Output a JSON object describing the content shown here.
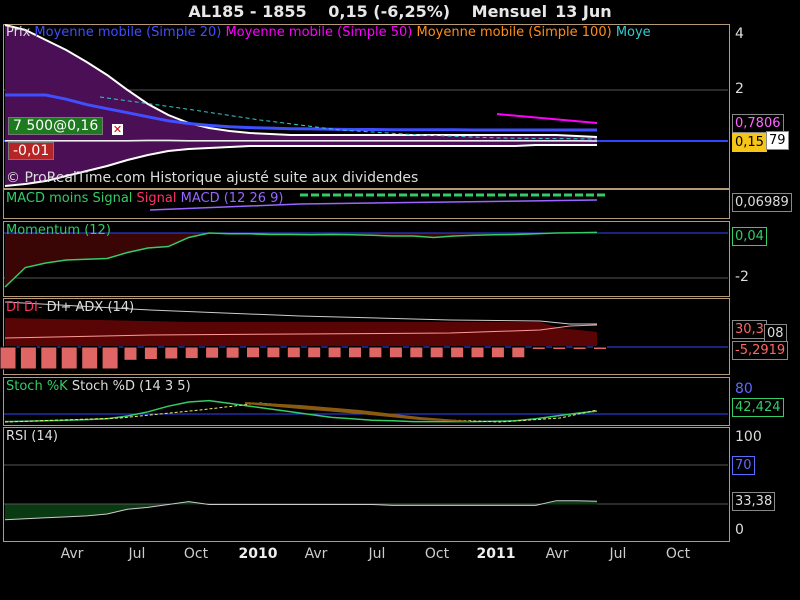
{
  "header": {
    "symbol": "AL185 - 1855",
    "price": "0,15 (-6,25%)",
    "period": "Mensuel",
    "date": "13 Jun"
  },
  "panels": {
    "price": {
      "legend": [
        {
          "text": "Prix",
          "color": "#dddddd"
        },
        {
          "text": "Moyenne mobile (Simple 20)",
          "color": "#3f4fff"
        },
        {
          "text": "Moyenne mobile (Simple 50)",
          "color": "#ff00ff"
        },
        {
          "text": "Moyenne mobile (Simple 100)",
          "color": "#ff8c1a"
        },
        {
          "text": "Moye",
          "color": "#33cccc"
        }
      ],
      "yticks": [
        "4",
        "2"
      ],
      "last_labels": [
        "0,7806",
        "0,15",
        "79"
      ],
      "order_tag": "7 500@0,16",
      "pl_tag": "-0,01",
      "source_note": "© ProRealTime.com Historique ajusté suite aux dividendes"
    },
    "macd": {
      "legend": [
        {
          "text": "MACD moins Signal",
          "color": "#33cc66"
        },
        {
          "text": "Signal",
          "color": "#ff3366"
        },
        {
          "text": "MACD (12 26 9)",
          "color": "#9966ff"
        }
      ],
      "last_label": "0,06989"
    },
    "momentum": {
      "legend": [
        {
          "text": "Momentum (12)",
          "color": "#33cc66"
        }
      ],
      "yticks": [
        "-2"
      ],
      "last_label": "0,04"
    },
    "dmi": {
      "legend": [
        {
          "text": "DI",
          "color": "#ff3366"
        },
        {
          "text": "DI-",
          "color": "#ff3366"
        },
        {
          "text": "DI+",
          "color": "#dddddd"
        },
        {
          "text": "ADX (14)",
          "color": "#dddddd"
        }
      ],
      "last_labels": [
        "30,3",
        "08",
        "-5,2919"
      ]
    },
    "stoch": {
      "legend": [
        {
          "text": "Stoch %K",
          "color": "#33cc66"
        },
        {
          "text": "Stoch %D (14 3 5)",
          "color": "#dddddd"
        }
      ],
      "yticks": [
        "80"
      ],
      "last_label": "42,424"
    },
    "rsi": {
      "legend": [
        {
          "text": "RSI (14)",
          "color": "#dddddd"
        }
      ],
      "yticks": [
        "100",
        "70",
        "0"
      ],
      "last_label": "33,38"
    }
  },
  "xaxis": [
    {
      "label": "Avr",
      "bold": false
    },
    {
      "label": "Jul",
      "bold": false
    },
    {
      "label": "Oct",
      "bold": false
    },
    {
      "label": "2010",
      "bold": true
    },
    {
      "label": "Avr",
      "bold": false
    },
    {
      "label": "Jul",
      "bold": false
    },
    {
      "label": "Oct",
      "bold": false
    },
    {
      "label": "2011",
      "bold": true
    },
    {
      "label": "Avr",
      "bold": false
    },
    {
      "label": "Jul",
      "bold": false
    },
    {
      "label": "Oct",
      "bold": false
    }
  ],
  "chart_data": [
    {
      "type": "line",
      "title": "AL185 - 1855 0,15 (-6,25%) Mensuel 13 Jun",
      "x": [
        "2009-01",
        "2009-02",
        "2009-03",
        "2009-04",
        "2009-05",
        "2009-06",
        "2009-07",
        "2009-08",
        "2009-09",
        "2009-10",
        "2009-11",
        "2009-12",
        "2010-01",
        "2010-02",
        "2010-03",
        "2010-04",
        "2010-05",
        "2010-06",
        "2010-07",
        "2010-08",
        "2010-09",
        "2010-10",
        "2010-11",
        "2010-12",
        "2011-01",
        "2011-02",
        "2011-03",
        "2011-04",
        "2011-05",
        "2011-06"
      ],
      "series": [
        {
          "name": "Prix",
          "values": [
            0.16,
            0.16,
            0.16,
            0.16,
            0.16,
            0.16,
            0.16,
            0.17,
            0.17,
            0.16,
            0.16,
            0.16,
            0.16,
            0.16,
            0.16,
            0.16,
            0.16,
            0.16,
            0.16,
            0.16,
            0.16,
            0.16,
            0.16,
            0.16,
            0.16,
            0.16,
            0.16,
            0.16,
            0.16,
            0.15
          ]
        },
        {
          "name": "Moyenne mobile (Simple 20)",
          "values": [
            1.9,
            1.7,
            1.5,
            1.3,
            1.1,
            0.95,
            0.8,
            0.65,
            0.5,
            0.4,
            0.33,
            0.28,
            0.25,
            0.23,
            0.21,
            0.2,
            0.19,
            0.18,
            0.18,
            0.17,
            0.17,
            0.17,
            0.17,
            0.16,
            0.16,
            0.16,
            0.16,
            0.16,
            0.16,
            0.16
          ]
        },
        {
          "name": "Moyenne mobile (Simple 50)",
          "values": [
            null,
            null,
            null,
            null,
            null,
            null,
            null,
            null,
            null,
            null,
            null,
            null,
            null,
            null,
            null,
            null,
            null,
            null,
            null,
            null,
            null,
            null,
            null,
            null,
            1.4,
            1.35,
            1.3,
            1.25,
            1.2,
            1.15
          ]
        }
      ],
      "ylim": [
        0,
        4.2
      ],
      "yticks": [
        2,
        4
      ]
    },
    {
      "type": "line",
      "title": "Momentum (12)",
      "series": [
        {
          "name": "Momentum (12)",
          "values": [
            -3.6,
            -2.3,
            -2.0,
            -1.8,
            -1.75,
            -1.7,
            -1.3,
            -1.0,
            -0.9,
            -0.3,
            0.0,
            -0.05,
            -0.05,
            -0.1,
            -0.1,
            -0.12,
            -0.1,
            -0.12,
            -0.15,
            -0.2,
            -0.2,
            -0.3,
            -0.2,
            -0.15,
            -0.12,
            -0.1,
            -0.05,
            0.0,
            0.02,
            0.04
          ]
        }
      ],
      "ylim": [
        -3.6,
        0.3
      ]
    },
    {
      "type": "bar",
      "title": "DI DI- DI+ ADX (14)",
      "series": [
        {
          "name": "DI",
          "values": [
            -5.3,
            -5.3,
            -5.3,
            -5.3,
            -5.3,
            -5.3,
            -3.2,
            -3.0,
            -2.9,
            -2.8,
            -2.7,
            -2.7,
            -2.6,
            -2.6,
            -2.6,
            -2.6,
            -2.6,
            -2.6,
            -2.6,
            -2.6,
            -2.6,
            -2.6,
            -2.6,
            -2.6,
            -2.6,
            -2.6,
            -0.6,
            -0.6,
            -0.6,
            -0.6
          ]
        }
      ]
    },
    {
      "type": "line",
      "title": "Stoch %K Stoch %D (14 3 5)",
      "series": [
        {
          "name": "Stoch %K",
          "values": [
            5,
            6,
            8,
            10,
            12,
            15,
            25,
            40,
            60,
            75,
            80,
            70,
            60,
            50,
            40,
            30,
            20,
            15,
            10,
            8,
            5,
            5,
            5,
            5,
            6,
            8,
            15,
            25,
            35,
            42.424
          ]
        }
      ],
      "ylim": [
        0,
        100
      ],
      "yticks": [
        80
      ]
    },
    {
      "type": "line",
      "title": "RSI (14)",
      "series": [
        {
          "name": "RSI (14)",
          "values": [
            14,
            15,
            16,
            17,
            18,
            20,
            25,
            27,
            30,
            33,
            30,
            30,
            30,
            30,
            30,
            30,
            30,
            30,
            30,
            29,
            29,
            29,
            29,
            29,
            29,
            29,
            29,
            34,
            34,
            33.38
          ]
        }
      ],
      "ylim": [
        0,
        100
      ],
      "yticks": [
        0,
        70,
        100
      ]
    }
  ],
  "colors": {
    "panel_border": "#b59a77",
    "bollinger_fill": "#4a0f55",
    "sma20": "#3f4fff",
    "sma50": "#ff00ff",
    "momentum_fill": "#3a0505",
    "momentum_line": "#33cc66",
    "di_bar": "#e06666",
    "dmi_fill": "#5a0505",
    "rsi_fill": "#0a3a12",
    "grid": "#555555"
  }
}
